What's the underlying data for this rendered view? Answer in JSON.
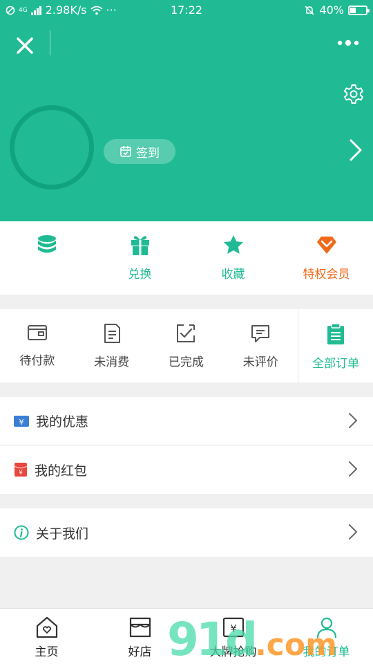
{
  "status_bar": {
    "network": "4G",
    "speed": "2.98K/s",
    "dots": "···",
    "time": "17:22",
    "battery": "40%"
  },
  "header": {
    "signin_label": "签到",
    "close_icon": "close-icon",
    "more_icon": "more-dots-icon",
    "settings_icon": "gear-icon",
    "colors": {
      "primary": "#20bb94",
      "avatar_ring": "#11a37f"
    }
  },
  "quick_actions": [
    {
      "icon": "coins-icon",
      "label": ""
    },
    {
      "icon": "gift-icon",
      "label": "兑换"
    },
    {
      "icon": "star-icon",
      "label": "收藏"
    },
    {
      "icon": "diamond-icon",
      "label": "特权会员"
    }
  ],
  "orders": [
    {
      "icon": "wallet-icon",
      "label": "待付款"
    },
    {
      "icon": "receipt-icon",
      "label": "未消费"
    },
    {
      "icon": "check-box-icon",
      "label": "已完成"
    },
    {
      "icon": "comment-icon",
      "label": "未评价"
    },
    {
      "icon": "clipboard-icon",
      "label": "全部订单"
    }
  ],
  "menu": {
    "coupons": "我的优惠",
    "red_packets": "我的红包",
    "about": "关于我们"
  },
  "bottom_nav": [
    {
      "icon": "home-icon",
      "label": "主页"
    },
    {
      "icon": "store-icon",
      "label": "好店"
    },
    {
      "icon": "brand-sale-icon",
      "label": "大牌抢购"
    },
    {
      "icon": "user-icon",
      "label": "我的订单"
    }
  ],
  "watermark": {
    "text": "91d",
    "suffix": ".com"
  }
}
